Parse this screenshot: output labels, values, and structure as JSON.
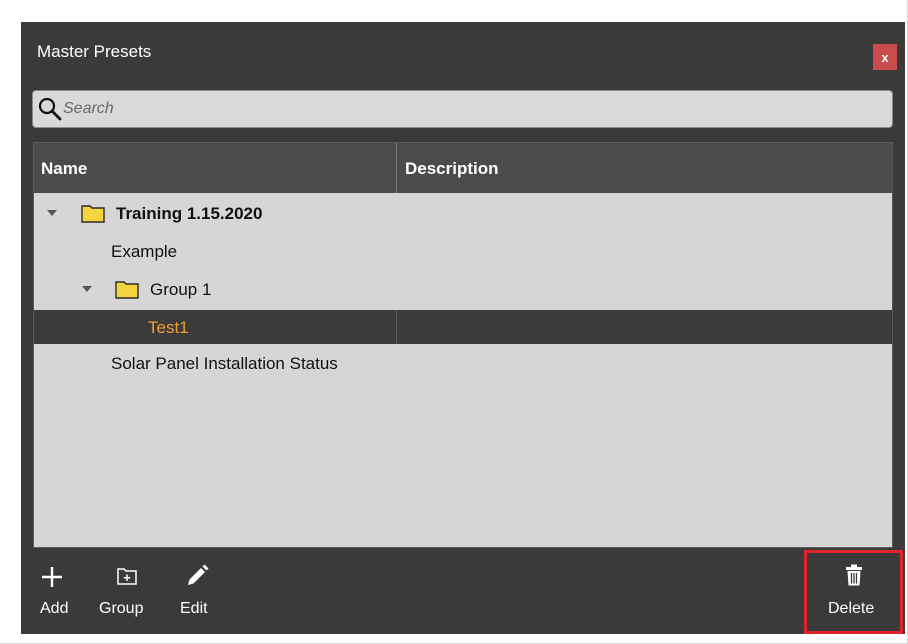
{
  "window": {
    "title": "Master Presets",
    "close_label": "x"
  },
  "search": {
    "placeholder": "Search",
    "value": ""
  },
  "tree": {
    "columns": [
      "Name",
      "Description"
    ],
    "rows": [
      {
        "label": "Training 1.15.2020",
        "type": "folder",
        "expanded": true,
        "bold": true,
        "selected": false
      },
      {
        "label": "Example",
        "type": "preset",
        "selected": false
      },
      {
        "label": "Group 1",
        "type": "folder",
        "expanded": true,
        "selected": false
      },
      {
        "label": "Test1",
        "type": "preset",
        "selected": true
      },
      {
        "label": "Solar Panel Installation Status",
        "type": "preset",
        "selected": false
      }
    ]
  },
  "toolbar": {
    "add_label": "Add",
    "group_label": "Group",
    "edit_label": "Edit",
    "delete_label": "Delete"
  },
  "icons": {
    "search": "search-icon",
    "folder": "folder-icon",
    "expander": "chevron-down-icon",
    "add": "plus-icon",
    "group": "add-folder-icon",
    "edit": "pencil-icon",
    "delete": "trash-icon",
    "close": "close-icon"
  },
  "colors": {
    "dialog_bg": "#3a3a3a",
    "tree_bg": "#d6d6d6",
    "header_bg": "#4b4b4b",
    "selected_row_bg": "#3b3b3b",
    "selected_text": "#f0a030",
    "close_button": "#c94b4b",
    "highlight_border": "#e2242a",
    "folder": "#f5d441"
  }
}
